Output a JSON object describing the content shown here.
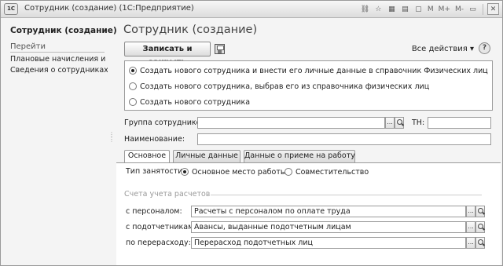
{
  "window": {
    "icon_text": "1C",
    "title": "Сотрудник (создание)  (1С:Предприятие)",
    "tools": {
      "m": "M",
      "m_plus": "M+",
      "m_minus": "M-"
    }
  },
  "sidebar": {
    "title": "Сотрудник (создание)",
    "section": "Перейти",
    "items": [
      {
        "label": "Плановые начисления и у..."
      },
      {
        "label": "Сведения о сотрудниках"
      }
    ]
  },
  "form": {
    "title": "Сотрудник (создание)",
    "save_close_label": "Записать и закрыть",
    "all_actions_label": "Все действия ▾",
    "help_label": "?",
    "create_options": [
      {
        "label": "Создать нового сотрудника и внести его личные данные в справочник Физических лиц",
        "selected": true
      },
      {
        "label": "Создать нового сотрудника, выбрав его из справочника физических лиц",
        "selected": false
      },
      {
        "label": "Создать нового сотрудника",
        "selected": false
      }
    ],
    "group_label": "Группа сотрудников:",
    "group_value": "",
    "choose_btn": "...",
    "tn_label": "ТН:",
    "tn_value": "",
    "name_label": "Наименование:",
    "name_value": "",
    "tabs": [
      {
        "label": "Основное",
        "active": true
      },
      {
        "label": "Личные данные",
        "active": false
      },
      {
        "label": "Данные о приеме на работу",
        "active": false
      }
    ],
    "employment_label": "Тип занятости:",
    "employment_options": [
      {
        "label": "Основное место работы",
        "selected": true
      },
      {
        "label": "Совместительство",
        "selected": false
      }
    ],
    "accounts_group": "Счета учета расчетов",
    "accounts": [
      {
        "label": "с персоналом:",
        "value": "Расчеты с персоналом по оплате труда"
      },
      {
        "label": "с подотчетниками:",
        "value": "Авансы, выданные подотчетным лицам"
      },
      {
        "label": "по перерасходу:",
        "value": "Перерасход подотчетных лиц"
      }
    ]
  }
}
